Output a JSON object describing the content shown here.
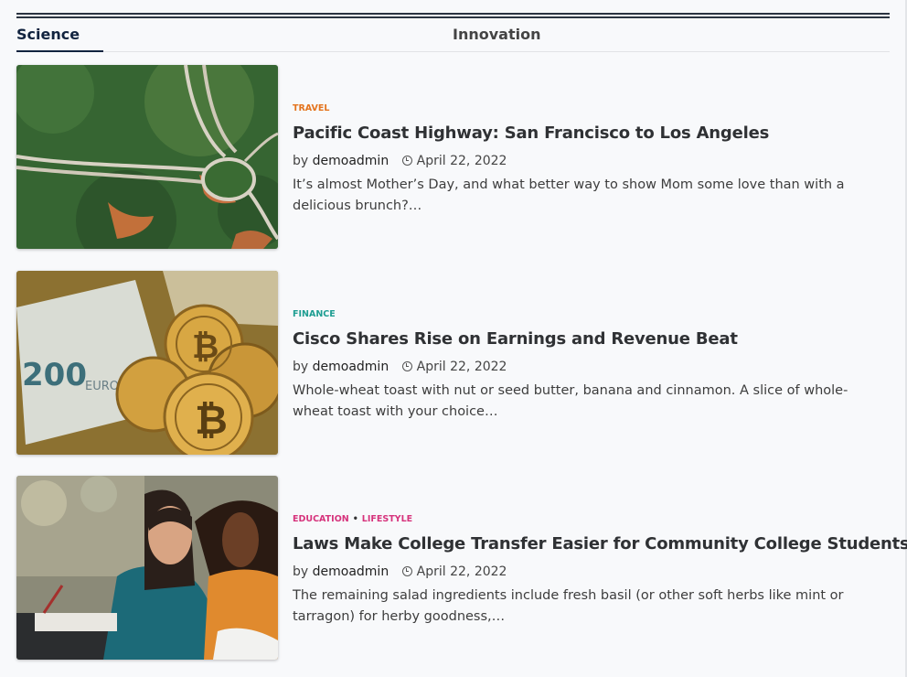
{
  "tabs": [
    {
      "label": "Science",
      "active": true
    },
    {
      "label": "Innovation",
      "active": false
    }
  ],
  "colors": {
    "travel": "#e4741e",
    "finance": "#1f9e92",
    "education": "#d6337c",
    "lifestyle": "#d6337c",
    "tab_active": "#11233f"
  },
  "posts": [
    {
      "image_icon": "aerial-highway-photo",
      "categories": [
        "TRAVEL"
      ],
      "title": "Pacific Coast Highway: San Francisco to Los Angeles",
      "by": "by",
      "author": "demoadmin",
      "date": "April 22, 2022",
      "excerpt": "It’s almost Mother’s Day, and what better way to show Mom some love than with a delicious brunch?…"
    },
    {
      "image_icon": "bitcoin-coins-photo",
      "categories": [
        "FINANCE"
      ],
      "title": "Cisco Shares Rise on Earnings and Revenue Beat",
      "by": "by",
      "author": "demoadmin",
      "date": "April 22, 2022",
      "excerpt": "Whole-wheat toast with nut or seed butter, banana and cinnamon. A slice of whole-wheat toast with your choice…"
    },
    {
      "image_icon": "students-studying-photo",
      "categories": [
        "EDUCATION",
        "LIFESTYLE"
      ],
      "title": "Laws Make College Transfer Easier for Community College Students",
      "by": "by",
      "author": "demoadmin",
      "date": "April 22, 2022",
      "excerpt": "The remaining salad ingredients include fresh basil (or other soft herbs like mint or tarragon) for herby goodness,…"
    }
  ]
}
